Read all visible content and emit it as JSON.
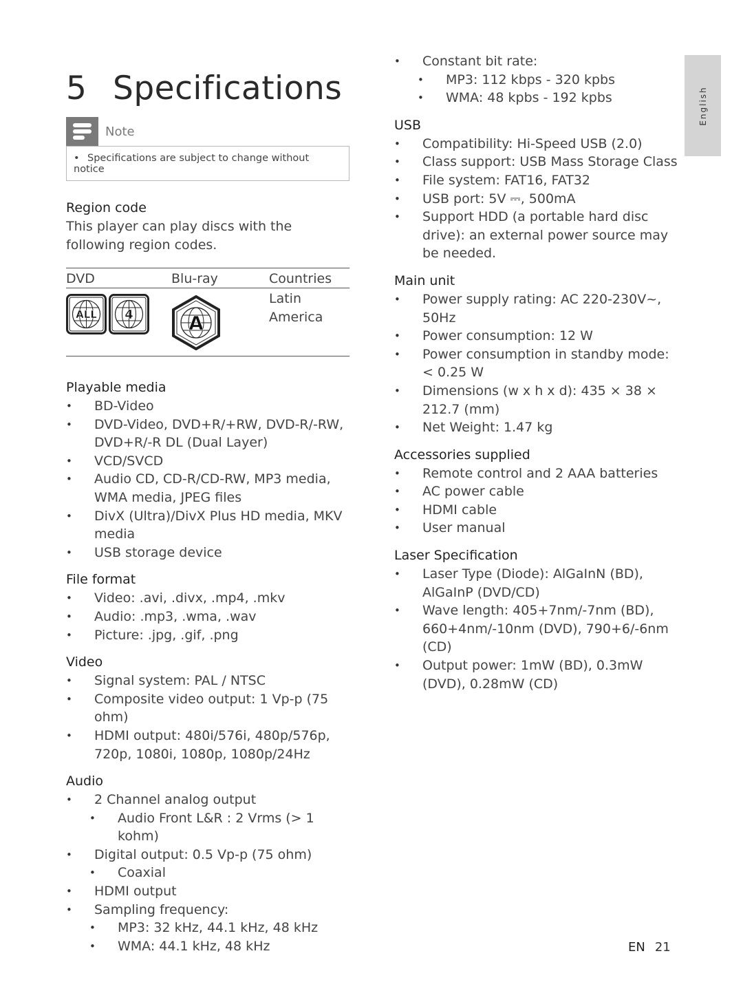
{
  "title": {
    "number": "5",
    "text": "Specifications"
  },
  "note": {
    "label": "Note",
    "text": "Specifications are subject to change without notice"
  },
  "region_code": {
    "heading": "Region code",
    "description": "This player can play discs with the following region codes.",
    "table": {
      "headers": [
        "DVD",
        "Blu-ray",
        "Countries"
      ],
      "rows": [
        {
          "dvd_icons": [
            "region-all-icon",
            "region-4-icon"
          ],
          "bluray_icon": "region-a-icon",
          "country": "Latin America"
        }
      ]
    }
  },
  "left_sections": [
    {
      "heading": "Playable media",
      "items": [
        {
          "text": "BD-Video"
        },
        {
          "text": "DVD-Video, DVD+R/+RW, DVD-R/-RW, DVD+R/-R DL (Dual Layer)"
        },
        {
          "text": "VCD/SVCD"
        },
        {
          "text": "Audio CD, CD-R/CD-RW, MP3 media, WMA media, JPEG files"
        },
        {
          "text": "DivX (Ultra)/DivX Plus HD media, MKV media"
        },
        {
          "text": "USB storage device"
        }
      ]
    },
    {
      "heading": "File format",
      "items": [
        {
          "text": "Video: .avi, .divx, .mp4, .mkv"
        },
        {
          "text": "Audio: .mp3, .wma, .wav"
        },
        {
          "text": "Picture: .jpg, .gif, .png"
        }
      ]
    },
    {
      "heading": "Video",
      "items": [
        {
          "text": "Signal system: PAL / NTSC"
        },
        {
          "text": "Composite video output: 1 Vp-p (75 ohm)"
        },
        {
          "text": "HDMI output: 480i/576i, 480p/576p, 720p, 1080i, 1080p, 1080p/24Hz"
        }
      ]
    },
    {
      "heading": "Audio",
      "items": [
        {
          "text": "2 Channel analog output"
        },
        {
          "text": "Audio Front L&R : 2 Vrms (> 1 kohm)",
          "sub": true
        },
        {
          "text": "Digital output: 0.5 Vp-p (75 ohm)"
        },
        {
          "text": "Coaxial",
          "sub": true
        },
        {
          "text": "HDMI output"
        },
        {
          "text": "Sampling frequency:"
        },
        {
          "text": "MP3: 32 kHz, 44.1 kHz, 48 kHz",
          "sub": true
        },
        {
          "text": "WMA: 44.1 kHz, 48 kHz",
          "sub": true
        }
      ]
    }
  ],
  "right_continued": [
    {
      "text": "Constant bit rate:"
    },
    {
      "text": "MP3: 112 kbps - 320 kpbs",
      "sub": true
    },
    {
      "text": "WMA: 48 kpbs - 192 kpbs",
      "sub": true
    }
  ],
  "right_sections": [
    {
      "heading": "USB",
      "items": [
        {
          "text": "Compatibility: Hi-Speed USB (2.0)"
        },
        {
          "text": "Class support: USB Mass Storage Class"
        },
        {
          "text": "File system: FAT16, FAT32"
        },
        {
          "text": "USB port: 5V ⎓, 500mA"
        },
        {
          "text": "Support HDD (a portable hard disc drive): an external power source may be needed."
        }
      ]
    },
    {
      "heading": "Main unit",
      "items": [
        {
          "text": "Power supply rating: AC 220-230V~, 50Hz"
        },
        {
          "text": "Power consumption: 12 W"
        },
        {
          "text": "Power consumption in standby mode: < 0.25 W"
        },
        {
          "text": "Dimensions (w x h x d): 435 × 38 × 212.7 (mm)"
        },
        {
          "text": "Net Weight: 1.47 kg"
        }
      ]
    },
    {
      "heading": "Accessories supplied",
      "items": [
        {
          "text": "Remote control and 2 AAA batteries"
        },
        {
          "text": "AC power cable"
        },
        {
          "text": "HDMI cable"
        },
        {
          "text": "User manual"
        }
      ]
    },
    {
      "heading": "Laser Specification",
      "items": [
        {
          "text": "Laser Type (Diode): AlGaInN (BD), AlGaInP (DVD/CD)"
        },
        {
          "text": "Wave length: 405+7nm/-7nm (BD), 660+4nm/-10nm (DVD), 790+6/-6nm (CD)"
        },
        {
          "text": "Output power: 1mW (BD), 0.3mW (DVD), 0.28mW (CD)"
        }
      ]
    }
  ],
  "language_tab": "English",
  "footer": {
    "lang": "EN",
    "page": "21"
  }
}
